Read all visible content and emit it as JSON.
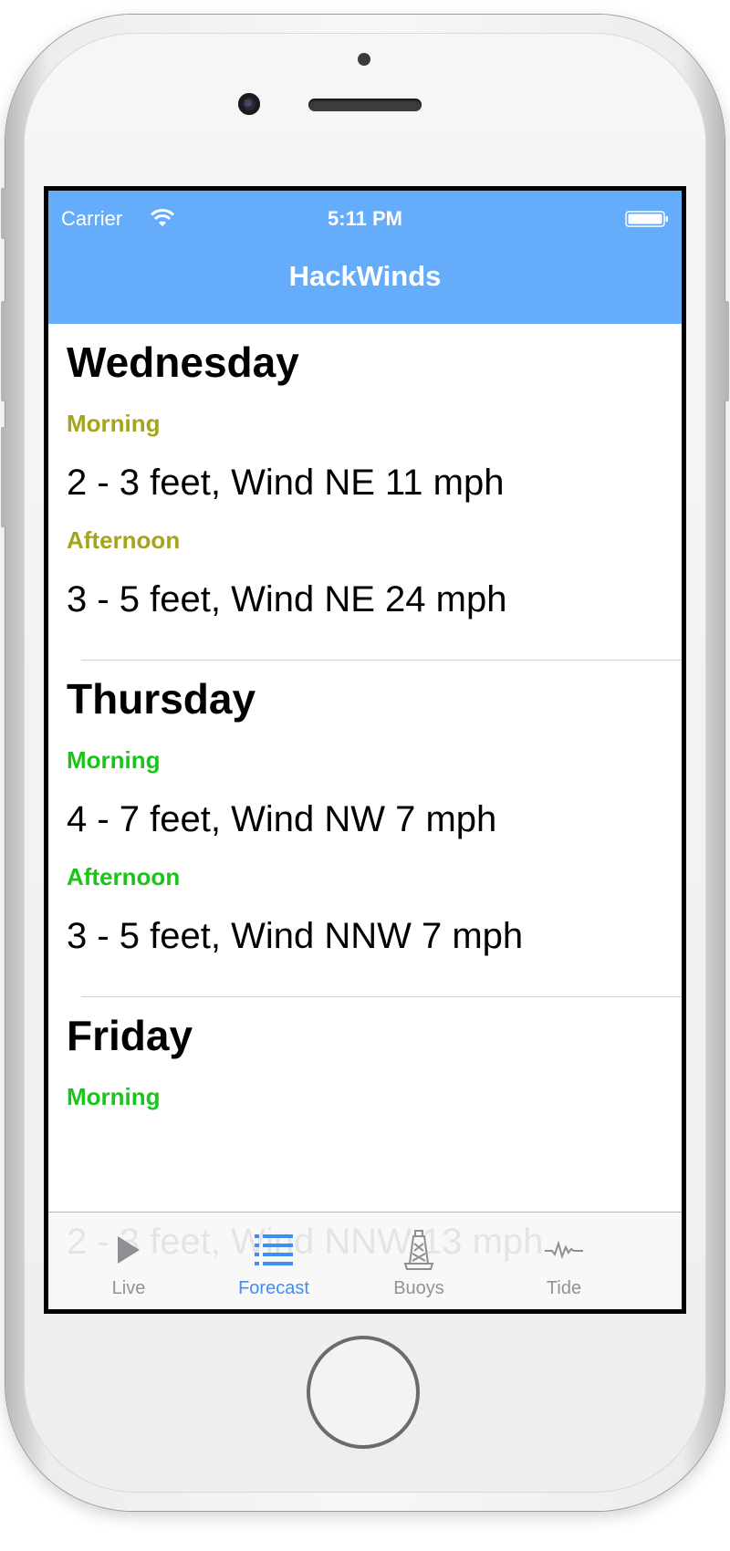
{
  "status_bar": {
    "carrier": "Carrier",
    "time": "5:11 PM"
  },
  "nav": {
    "title": "HackWinds"
  },
  "forecast": [
    {
      "day": "Wednesday",
      "periods": [
        {
          "label": "Morning",
          "conditions": "2 - 3 feet, Wind NE 11 mph"
        },
        {
          "label": "Afternoon",
          "conditions": "3 - 5 feet, Wind NE 24 mph"
        }
      ]
    },
    {
      "day": "Thursday",
      "periods": [
        {
          "label": "Morning",
          "conditions": "4 - 7 feet, Wind NW 7 mph"
        },
        {
          "label": "Afternoon",
          "conditions": "3 - 5 feet, Wind NNW 7 mph"
        }
      ]
    },
    {
      "day": "Friday",
      "periods": [
        {
          "label": "Morning",
          "conditions": "2 - 3 feet, Wind NNW 13 mph"
        }
      ]
    }
  ],
  "tabs": [
    {
      "label": "Live",
      "icon": "play-icon",
      "active": false
    },
    {
      "label": "Forecast",
      "icon": "list-icon",
      "active": true
    },
    {
      "label": "Buoys",
      "icon": "buoy-icon",
      "active": false
    },
    {
      "label": "Tide",
      "icon": "wave-icon",
      "active": false
    }
  ],
  "colors": {
    "nav_bar": "#65acfb",
    "rating_yellow": "#a6a41a",
    "rating_green": "#1ac51a",
    "tab_active": "#3f8ef5",
    "tab_inactive": "#929292"
  }
}
